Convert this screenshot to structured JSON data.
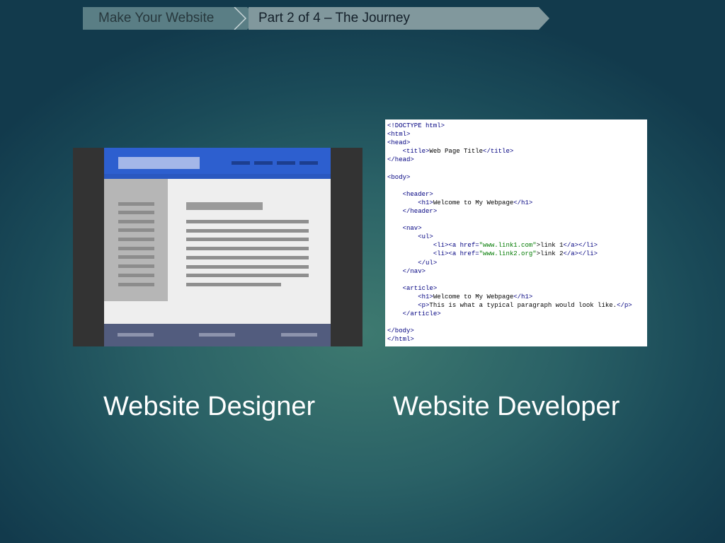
{
  "breadcrumb": {
    "items": [
      {
        "label": "Make Your Website"
      },
      {
        "label": "Part 2 of 4 – The Journey"
      }
    ]
  },
  "cards": [
    {
      "caption": "Website Designer",
      "image": "website-wireframe-mockup"
    },
    {
      "caption": "Website Developer",
      "image": "html-source-code-screenshot"
    }
  ],
  "code_lines": [
    [
      "<!DOCTYPE html>"
    ],
    [
      "<html>"
    ],
    [
      "<head>"
    ],
    [
      "    ",
      "<title>",
      "Web Page Title",
      "</title>"
    ],
    [
      "</head>"
    ],
    [
      ""
    ],
    [
      "<body>"
    ],
    [
      ""
    ],
    [
      "    ",
      "<header>"
    ],
    [
      "        ",
      "<h1>",
      "Welcome to My Webpage",
      "</h1>"
    ],
    [
      "    ",
      "</header>"
    ],
    [
      ""
    ],
    [
      "    ",
      "<nav>"
    ],
    [
      "        ",
      "<ul>"
    ],
    [
      "            ",
      "<li>",
      "<a ",
      "href=",
      "\"www.link1.com\"",
      ">",
      "link 1",
      "</a>",
      "</li>"
    ],
    [
      "            ",
      "<li>",
      "<a ",
      "href=",
      "\"www.link2.org\"",
      ">",
      "link 2",
      "</a>",
      "</li>"
    ],
    [
      "        ",
      "</ul>"
    ],
    [
      "    ",
      "</nav>"
    ],
    [
      ""
    ],
    [
      "    ",
      "<article>"
    ],
    [
      "        ",
      "<h1>",
      "Welcome to My Webpage",
      "</h1>"
    ],
    [
      "        ",
      "<p>",
      "This is what a typical paragraph would look like.",
      "</p>"
    ],
    [
      "    ",
      "</article>"
    ],
    [
      ""
    ],
    [
      "</body>"
    ],
    [
      "</html>"
    ]
  ],
  "colors": {
    "background": "#2a6166",
    "breadcrumb_first": "#5a7e85",
    "breadcrumb_second": "#81989d",
    "mockup_header": "#2d5fcf",
    "code_tag": "#000080",
    "code_attr_value": "#007a00"
  }
}
